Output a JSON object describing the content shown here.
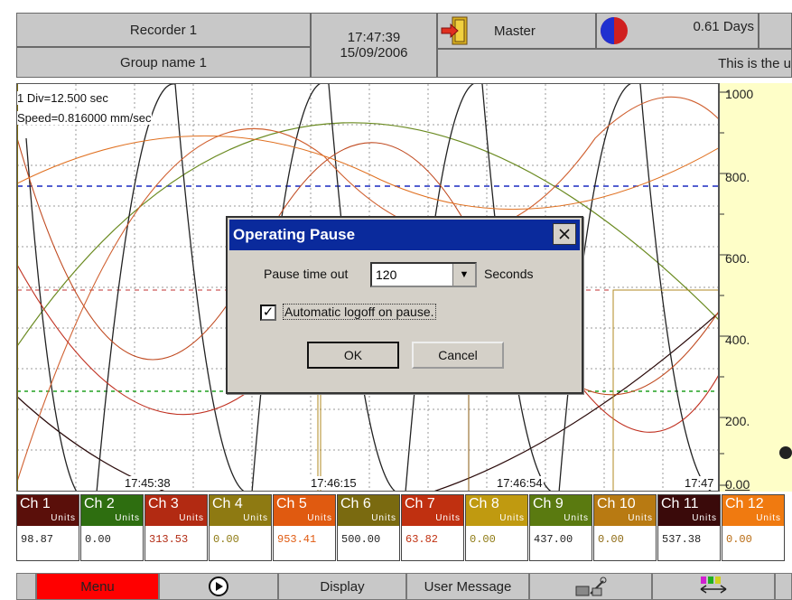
{
  "header": {
    "recorder": "Recorder 1",
    "group": "Group name 1",
    "time": "17:47:39",
    "date": "15/09/2006",
    "user": "Master",
    "days": "0.61 Days",
    "message": "This is the u"
  },
  "chart": {
    "division": "1 Div=12.500 sec",
    "speed": "Speed=0.816000 mm/sec",
    "timestamps": [
      "17:45:38",
      "17:46:15",
      "17:46:54",
      "17:47"
    ],
    "scale": [
      "1000",
      "800.",
      "600.",
      "400.",
      "200.",
      "0.00"
    ]
  },
  "channels": [
    {
      "name": "Ch 1",
      "unit": "Units",
      "value": "98.87",
      "color": "#5a0f0a",
      "text": "#222"
    },
    {
      "name": "Ch 2",
      "unit": "Units",
      "value": "0.00",
      "color": "#2e6e10",
      "text": "#222"
    },
    {
      "name": "Ch 3",
      "unit": "Units",
      "value": "313.53",
      "color": "#b22a12",
      "text": "#b22a12"
    },
    {
      "name": "Ch 4",
      "unit": "Units",
      "value": "0.00",
      "color": "#8e7a12",
      "text": "#8e7a12"
    },
    {
      "name": "Ch 5",
      "unit": "Units",
      "value": "953.41",
      "color": "#e05a10",
      "text": "#e05a10"
    },
    {
      "name": "Ch 6",
      "unit": "Units",
      "value": "500.00",
      "color": "#7a6a10",
      "text": "#222"
    },
    {
      "name": "Ch 7",
      "unit": "Units",
      "value": "63.82",
      "color": "#c03010",
      "text": "#c03010"
    },
    {
      "name": "Ch 8",
      "unit": "Units",
      "value": "0.00",
      "color": "#c09a10",
      "text": "#8e7a12"
    },
    {
      "name": "Ch 9",
      "unit": "Units",
      "value": "437.00",
      "color": "#5a7a10",
      "text": "#222"
    },
    {
      "name": "Ch 10",
      "unit": "Units",
      "value": "0.00",
      "color": "#b87a12",
      "text": "#8e6a12"
    },
    {
      "name": "Ch 11",
      "unit": "Units",
      "value": "537.38",
      "color": "#3a0a0a",
      "text": "#222"
    },
    {
      "name": "Ch 12",
      "unit": "Units",
      "value": "0.00",
      "color": "#f07a10",
      "text": "#b86a10"
    }
  ],
  "toolbar": {
    "menu": "Menu",
    "display": "Display",
    "user_message": "User Message"
  },
  "dialog": {
    "title": "Operating Pause",
    "pause_label": "Pause time out",
    "pause_value": "120",
    "unit": "Seconds",
    "checkbox_label": "Automatic logoff on pause.",
    "checkbox_checked": true,
    "ok": "OK",
    "cancel": "Cancel"
  }
}
